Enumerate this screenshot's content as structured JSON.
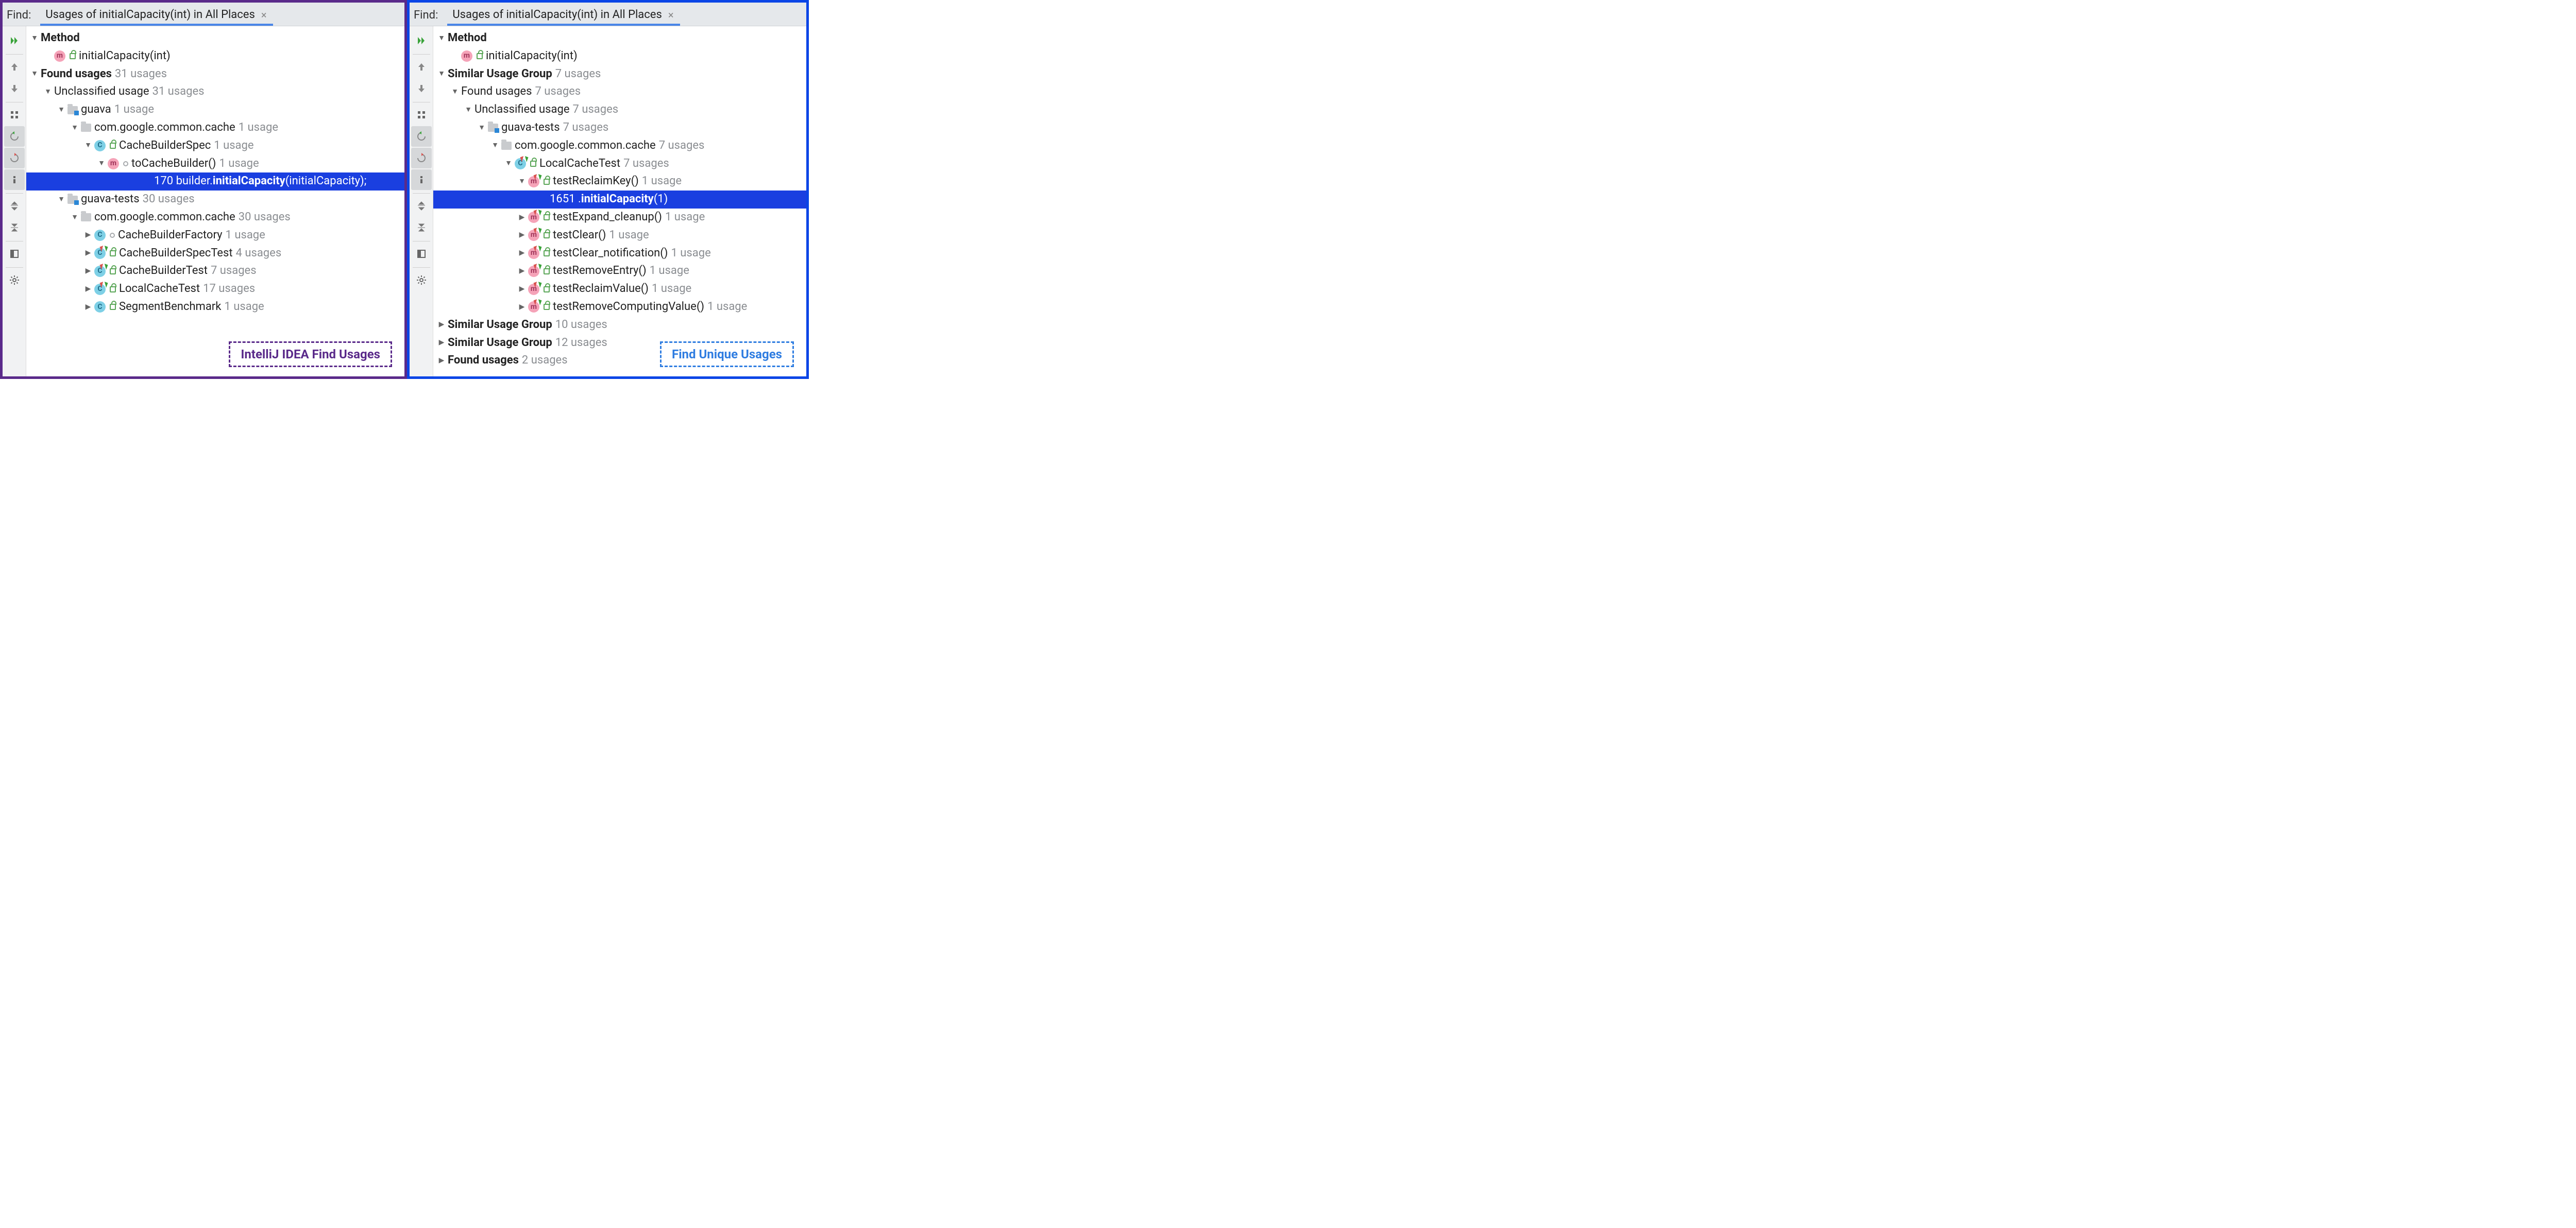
{
  "left": {
    "find_label": "Find:",
    "tab_title": "Usages of initialCapacity(int) in All Places",
    "caption": "IntelliJ IDEA Find Usages",
    "tree": {
      "method_header": "Method",
      "method_name": "initialCapacity(int)",
      "found_header": "Found usages",
      "found_count": "31 usages",
      "unclassified": "Unclassified usage",
      "unclassified_count": "31 usages",
      "module_guava": "guava",
      "module_guava_count": "1 usage",
      "pkg": "com.google.common.cache",
      "pkg_count": "1 usage",
      "class1": "CacheBuilderSpec",
      "class1_count": "1 usage",
      "method1": "toCacheBuilder()",
      "method1_count": "1 usage",
      "line_no": "170",
      "line_pre": "builder.",
      "line_bold": "initialCapacity",
      "line_post": "(initialCapacity);",
      "module_tests": "guava-tests",
      "module_tests_count": "30 usages",
      "pkg2_count": "30 usages",
      "c_factory": "CacheBuilderFactory",
      "c_factory_count": "1 usage",
      "c_spectest": "CacheBuilderSpecTest",
      "c_spectest_count": "4 usages",
      "c_buildertest": "CacheBuilderTest",
      "c_buildertest_count": "7 usages",
      "c_localcache": "LocalCacheTest",
      "c_localcache_count": "17 usages",
      "c_segbench": "SegmentBenchmark",
      "c_segbench_count": "1 usage"
    }
  },
  "right": {
    "find_label": "Find:",
    "tab_title": "Usages of initialCapacity(int) in All Places",
    "caption": "Find Unique Usages",
    "tree": {
      "method_header": "Method",
      "method_name": "initialCapacity(int)",
      "sim1": "Similar Usage Group",
      "sim1_count": "7 usages",
      "found": "Found usages",
      "found_count": "7 usages",
      "unclassified": "Unclassified usage",
      "unclassified_count": "7 usages",
      "module": "guava-tests",
      "module_count": "7 usages",
      "pkg": "com.google.common.cache",
      "pkg_count": "7 usages",
      "cls": "LocalCacheTest",
      "cls_count": "7 usages",
      "m_reclaimkey": "testReclaimKey()",
      "m_reclaimkey_count": "1 usage",
      "line_no": "1651",
      "line_pre": ".",
      "line_bold": "initialCapacity",
      "line_post": "(1)",
      "m_expand": "testExpand_cleanup()",
      "m_expand_count": "1 usage",
      "m_clear": "testClear()",
      "m_clear_count": "1 usage",
      "m_clearnotif": "testClear_notification()",
      "m_clearnotif_count": "1 usage",
      "m_remove": "testRemoveEntry()",
      "m_remove_count": "1 usage",
      "m_reclaimval": "testReclaimValue()",
      "m_reclaimval_count": "1 usage",
      "m_removecomp": "testRemoveComputingValue()",
      "m_removecomp_count": "1 usage",
      "sim2": "Similar Usage Group",
      "sim2_count": "10 usages",
      "sim3": "Similar Usage Group",
      "sim3_count": "12 usages",
      "found2": "Found usages",
      "found2_count": "2 usages"
    }
  }
}
